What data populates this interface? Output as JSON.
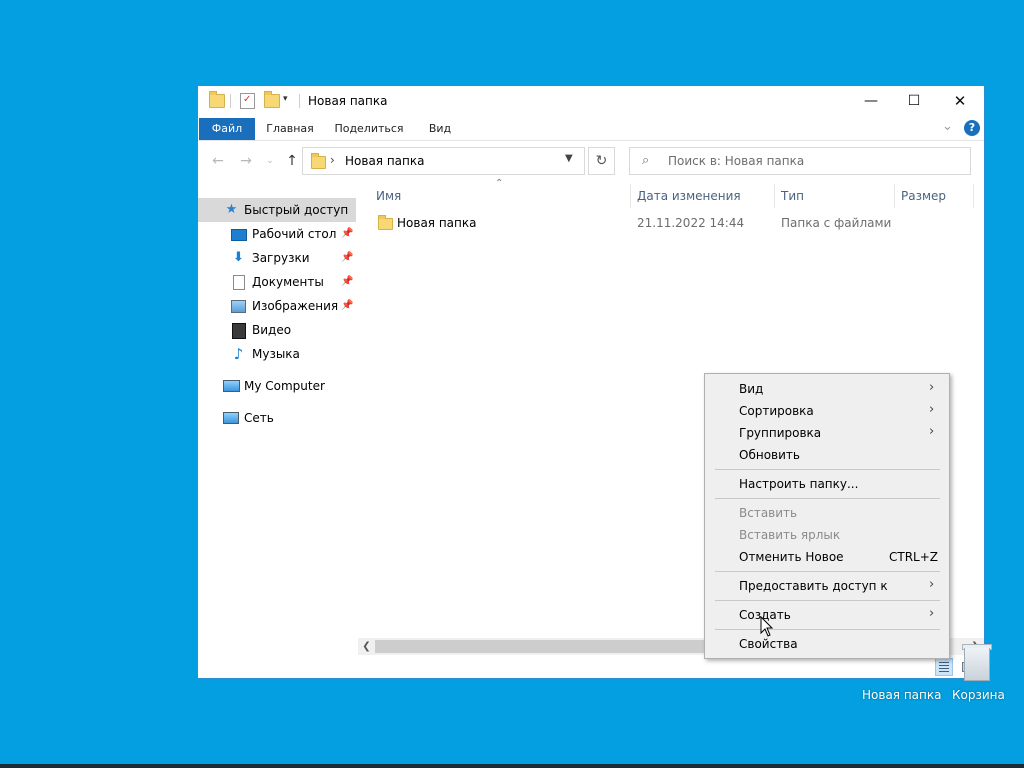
{
  "window": {
    "title": "Новая папка",
    "controls": {
      "minimize": "—",
      "maximize": "☐",
      "close": "✕"
    }
  },
  "ribbon": {
    "tabs": [
      "Файл",
      "Главная",
      "Поделиться",
      "Вид"
    ],
    "help": "?"
  },
  "address_bar": {
    "path": "Новая папка",
    "search_placeholder": "Поиск в: Новая папка"
  },
  "sidebar": {
    "items": [
      {
        "label": "Быстрый доступ",
        "icon": "star-icon",
        "active": true
      },
      {
        "label": "Рабочий стол",
        "icon": "desktop-icon",
        "pinned": true
      },
      {
        "label": "Загрузки",
        "icon": "download-icon",
        "pinned": true
      },
      {
        "label": "Документы",
        "icon": "documents-icon",
        "pinned": true
      },
      {
        "label": "Изображения",
        "icon": "pictures-icon",
        "pinned": true
      },
      {
        "label": "Видео",
        "icon": "video-icon"
      },
      {
        "label": "Музыка",
        "icon": "music-icon"
      },
      {
        "label": "My Computer",
        "icon": "computer-icon"
      },
      {
        "label": "Сеть",
        "icon": "network-icon"
      }
    ]
  },
  "file_list": {
    "columns": [
      "Имя",
      "Дата изменения",
      "Тип",
      "Размер"
    ],
    "rows": [
      {
        "name": "Новая папка",
        "date": "21.11.2022 14:44",
        "type": "Папка с файлами",
        "size": ""
      }
    ]
  },
  "context_menu": {
    "items": [
      {
        "label": "Вид",
        "submenu": true
      },
      {
        "label": "Сортировка",
        "submenu": true
      },
      {
        "label": "Группировка",
        "submenu": true
      },
      {
        "label": "Обновить"
      },
      {
        "label": "Настроить папку..."
      },
      {
        "label": "Вставить",
        "disabled": true
      },
      {
        "label": "Вставить ярлык",
        "disabled": true
      },
      {
        "label": "Отменить Новое",
        "shortcut": "CTRL+Z"
      },
      {
        "label": "Предоставить доступ к",
        "submenu": true
      },
      {
        "label": "Создать",
        "submenu": true
      },
      {
        "label": "Свойства"
      }
    ]
  },
  "desktop": {
    "icons": [
      "Новая папка",
      "Корзина"
    ]
  },
  "colors": {
    "desktop": "#039fe0",
    "accent": "#1a6fbd",
    "selection": "#d9d9d9"
  }
}
